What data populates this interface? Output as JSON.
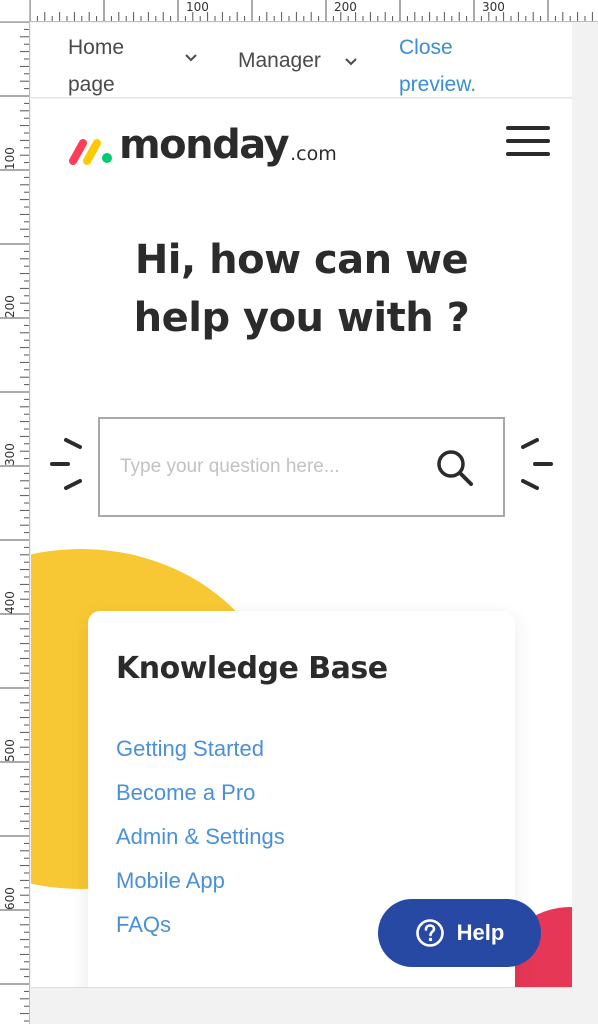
{
  "ruler": {
    "top_labels": [
      "100",
      "200",
      "300"
    ],
    "left_labels": [
      "100",
      "200",
      "300",
      "400",
      "500",
      "600"
    ]
  },
  "preview_bar": {
    "home_label": "Home page",
    "manager_label": "Manager",
    "close_label": "Close preview.",
    "chevron_icon": "chevron-down-icon"
  },
  "header": {
    "logo_word": "monday",
    "logo_suffix": ".com",
    "logo_colors": [
      "#ff3d57",
      "#ffcb00",
      "#00ca72"
    ],
    "menu_icon": "hamburger-menu-icon"
  },
  "hero": {
    "line1": "Hi, how can we",
    "line2": "help you with ?"
  },
  "search": {
    "placeholder": "Type your question here...",
    "icon": "search-icon"
  },
  "knowledge_base": {
    "title": "Knowledge Base",
    "links": [
      "Getting Started",
      "Become a Pro",
      "Admin & Settings",
      "Mobile App",
      "FAQs"
    ]
  },
  "help": {
    "label": "Help",
    "icon": "question-circle-icon",
    "color": "#2748a3"
  },
  "colors": {
    "accent_yellow": "#f8c834",
    "accent_red": "#e63756",
    "link_blue": "#4a90d9"
  }
}
